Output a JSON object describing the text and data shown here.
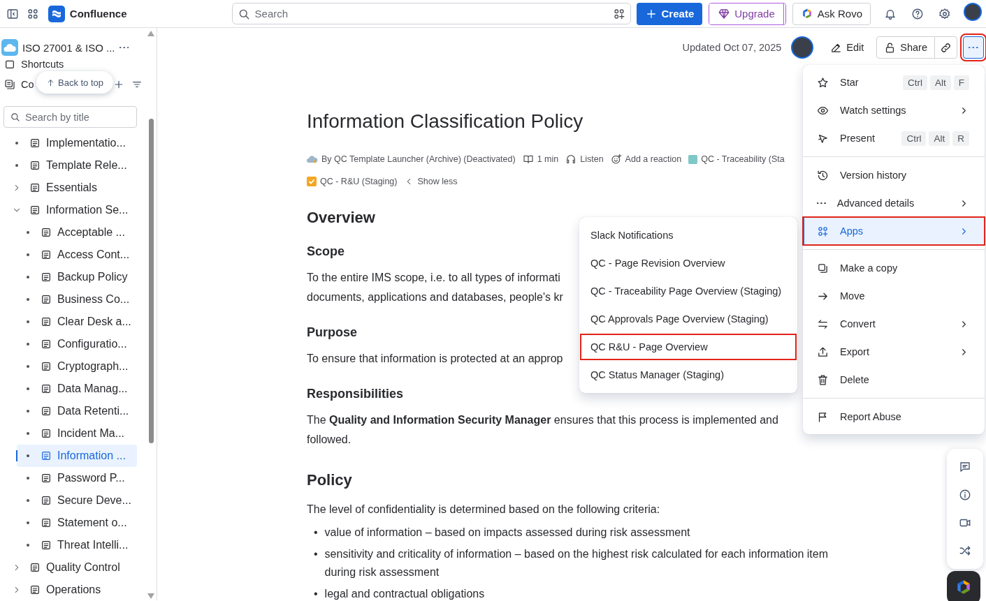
{
  "topbar": {
    "product": "Confluence",
    "search": {
      "placeholder": "Search"
    },
    "create": "Create",
    "upgrade": "Upgrade",
    "ask": "Ask Rovo"
  },
  "sidebar": {
    "space": "ISO 27001 & ISO ...",
    "shortcuts": "Shortcuts",
    "content": "Co",
    "back_to_top": "Back to top",
    "search": {
      "placeholder": "Search by title"
    },
    "tree": [
      {
        "label": "Implementatio...",
        "kind": "leaf",
        "selected": false
      },
      {
        "label": "Template Rele...",
        "kind": "leaf",
        "selected": false
      },
      {
        "label": "Essentials",
        "kind": "folder",
        "expanded": false,
        "selected": false
      },
      {
        "label": "Information Se...",
        "kind": "folder",
        "expanded": true,
        "selected": false,
        "children": [
          {
            "label": "Acceptable ...",
            "kind": "leaf",
            "selected": false
          },
          {
            "label": "Access Cont...",
            "kind": "leaf",
            "selected": false
          },
          {
            "label": "Backup Policy",
            "kind": "leaf",
            "selected": false
          },
          {
            "label": "Business Co...",
            "kind": "leaf",
            "selected": false
          },
          {
            "label": "Clear Desk a...",
            "kind": "leaf",
            "selected": false
          },
          {
            "label": "Configuratio...",
            "kind": "leaf",
            "selected": false
          },
          {
            "label": "Cryptograph...",
            "kind": "leaf",
            "selected": false
          },
          {
            "label": "Data Manag...",
            "kind": "leaf",
            "selected": false
          },
          {
            "label": "Data Retenti...",
            "kind": "leaf",
            "selected": false
          },
          {
            "label": "Incident Ma...",
            "kind": "leaf",
            "selected": false
          },
          {
            "label": "Information ...",
            "kind": "leaf",
            "selected": true
          },
          {
            "label": "Password P...",
            "kind": "leaf",
            "selected": false
          },
          {
            "label": "Secure Deve...",
            "kind": "leaf",
            "selected": false
          },
          {
            "label": "Statement o...",
            "kind": "leaf",
            "selected": false
          },
          {
            "label": "Threat Intelli...",
            "kind": "leaf",
            "selected": false
          }
        ]
      },
      {
        "label": "Quality Control",
        "kind": "folder",
        "expanded": false,
        "selected": false
      },
      {
        "label": "Operations",
        "kind": "folder",
        "expanded": false,
        "selected": false
      }
    ]
  },
  "page": {
    "updated": "Updated Oct 07, 2025",
    "edit": "Edit",
    "share": "Share",
    "more_highlighted": true,
    "title": "Information Classification Policy",
    "meta_rows": [
      [
        {
          "kind": "author",
          "text": "By QC Template Launcher (Archive) (Deactivated)"
        },
        {
          "kind": "read",
          "text": "1 min"
        },
        {
          "kind": "listen",
          "text": "Listen"
        },
        {
          "kind": "reaction",
          "text": "Add a reaction"
        },
        {
          "kind": "app",
          "text": "QC - Traceability (Sta"
        }
      ],
      [
        {
          "kind": "app-check",
          "text": "QC - R&U (Staging)"
        },
        {
          "kind": "less",
          "text": "Show less"
        }
      ]
    ],
    "body": [
      {
        "kind": "h2",
        "text": "Overview"
      },
      {
        "kind": "h3",
        "text": "Scope"
      },
      {
        "kind": "p",
        "lines": [
          "To the entire IMS scope, i.e. to all types of informati",
          "documents, applications and databases, people's kr"
        ]
      },
      {
        "kind": "h3",
        "text": "Purpose"
      },
      {
        "kind": "p",
        "lines": [
          "To ensure that information is protected at an approp"
        ]
      },
      {
        "kind": "h3",
        "text": "Responsibilities"
      },
      {
        "kind": "p",
        "lines": [
          "The **Quality and Information Security Manager** ensures that this process is implemented and",
          "followed."
        ]
      },
      {
        "kind": "h2",
        "text": "Policy"
      },
      {
        "kind": "p",
        "lines": [
          "The level of confidentiality is determined based on the following criteria:"
        ]
      },
      {
        "kind": "ul",
        "marker": "•",
        "items": [
          "value of information – based on impacts assessed during risk assessment",
          "sensitivity and criticality of information – based on the highest risk calculated for each information item during risk assessment",
          "legal and contractual obligations"
        ]
      }
    ]
  },
  "menu": {
    "groups": [
      {
        "items": [
          {
            "label": "Star",
            "keys": [
              "Ctrl",
              "Alt",
              "F"
            ],
            "submenu": false,
            "selected": false,
            "highlighted": false
          },
          {
            "label": "Watch settings",
            "submenu": true,
            "selected": false,
            "highlighted": false
          },
          {
            "label": "Present",
            "keys": [
              "Ctrl",
              "Alt",
              "R"
            ],
            "submenu": false,
            "selected": false,
            "highlighted": false
          }
        ]
      },
      {
        "items": [
          {
            "label": "Version history",
            "submenu": false,
            "selected": false,
            "highlighted": false
          },
          {
            "label": "Advanced details",
            "submenu": true,
            "selected": false,
            "highlighted": false
          },
          {
            "label": "Apps",
            "submenu": true,
            "selected": true,
            "highlighted": true
          }
        ]
      },
      {
        "items": [
          {
            "label": "Make a copy",
            "submenu": false,
            "selected": false,
            "highlighted": false
          },
          {
            "label": "Move",
            "submenu": false,
            "selected": false,
            "highlighted": false
          },
          {
            "label": "Convert",
            "submenu": true,
            "selected": false,
            "highlighted": false
          },
          {
            "label": "Export",
            "submenu": true,
            "selected": false,
            "highlighted": false
          },
          {
            "label": "Delete",
            "submenu": false,
            "selected": false,
            "highlighted": false
          }
        ]
      },
      {
        "items": [
          {
            "label": "Report Abuse",
            "submenu": false,
            "selected": false,
            "highlighted": false
          }
        ]
      }
    ]
  },
  "apps_menu": {
    "items": [
      {
        "label": "Slack Notifications",
        "highlighted": false
      },
      {
        "label": "QC - Page Revision Overview",
        "highlighted": false
      },
      {
        "label": "QC - Traceability Page Overview (Staging)",
        "highlighted": false
      },
      {
        "label": "QC Approvals Page Overview (Staging)",
        "highlighted": false
      },
      {
        "label": "QC R&U - Page Overview",
        "highlighted": true
      },
      {
        "label": "QC Status Manager (Staging)",
        "highlighted": false
      }
    ]
  }
}
